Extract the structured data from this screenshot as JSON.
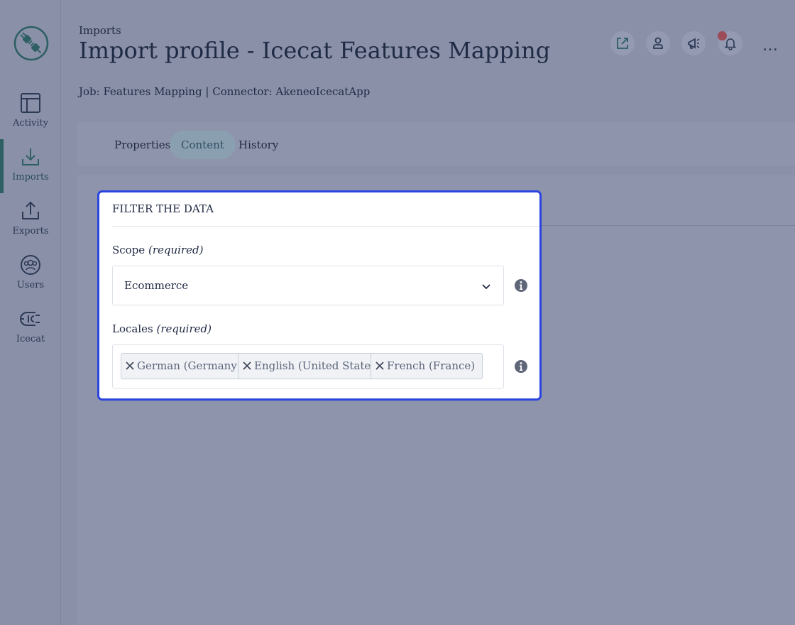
{
  "sidebar": {
    "items": [
      {
        "label": "Activity",
        "icon": "activity-icon"
      },
      {
        "label": "Imports",
        "icon": "import-icon",
        "active": true
      },
      {
        "label": "Exports",
        "icon": "export-icon"
      },
      {
        "label": "Users",
        "icon": "users-icon"
      },
      {
        "label": "Icecat",
        "icon": "icecat-icon"
      }
    ]
  },
  "header": {
    "breadcrumb": "Imports",
    "title": "Import profile - Icecat Features Mapping",
    "meta": "Job: Features Mapping | Connector: AkeneoIcecatApp",
    "more": "…"
  },
  "tabs": [
    {
      "label": "Properties"
    },
    {
      "label": "Content",
      "active": true
    },
    {
      "label": "History"
    }
  ],
  "filter": {
    "title": "FILTER THE DATA",
    "scope": {
      "label": "Scope",
      "required": "(required)",
      "value": "Ecommerce"
    },
    "locales": {
      "label": "Locales",
      "required": "(required)",
      "values": [
        "German (Germany)",
        "English (United States)",
        "French (France)"
      ]
    }
  },
  "colors": {
    "highlight": "#2b44e0",
    "notification": "#9b4c58",
    "active_nav": "#2d5f63"
  }
}
